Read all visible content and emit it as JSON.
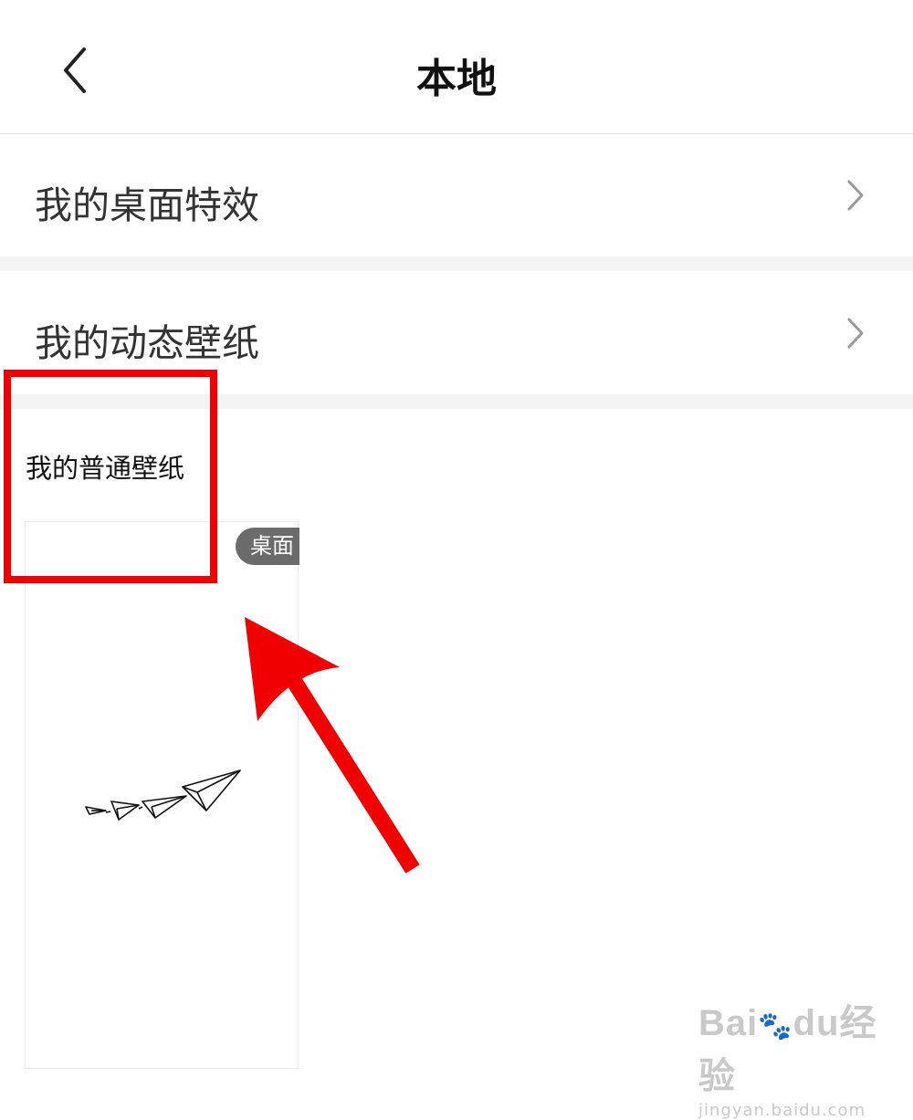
{
  "header": {
    "title": "本地"
  },
  "rows": [
    {
      "label": "我的桌面特效"
    },
    {
      "label": "我的动态壁纸"
    }
  ],
  "normal_wallpaper": {
    "section_title": "我的普通壁纸",
    "items": [
      {
        "tag": "桌面"
      }
    ]
  },
  "annotation": {
    "color": "#f00000"
  },
  "watermark": {
    "brand": "Bai",
    "brand2": "du",
    "product": "经验",
    "url": "jingyan.baidu.com"
  }
}
